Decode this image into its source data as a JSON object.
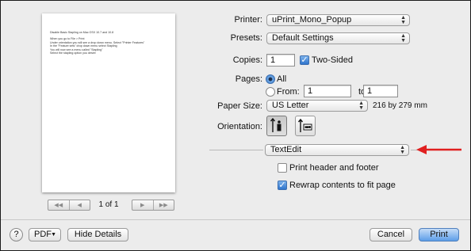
{
  "preview": {
    "lines": [
      "Disable Basic Stapling on Mac OSX 10.7 and 10.8",
      "When you go to File > Print",
      "Under orientation you will see a drop down menu. Select \"Printer Features\"",
      "In the \"Feature sets\" drop down menu select Stapling",
      "You will now see a menu called \"Stapling\"",
      "Select the stapling option you desire"
    ],
    "page_indicator": "1 of 1"
  },
  "printer": {
    "label": "Printer:",
    "value": "uPrint_Mono_Popup"
  },
  "presets": {
    "label": "Presets:",
    "value": "Default Settings"
  },
  "copies": {
    "label": "Copies:",
    "value": "1",
    "two_sided_label": "Two-Sided",
    "two_sided_checked": true
  },
  "pages": {
    "label": "Pages:",
    "all_label": "All",
    "from_label": "From:",
    "from_value": "1",
    "to_label": "to:",
    "to_value": "1"
  },
  "paper_size": {
    "label": "Paper Size:",
    "value": "US Letter",
    "dimensions": "216 by 279 mm"
  },
  "orientation": {
    "label": "Orientation:"
  },
  "section_popup": {
    "value": "TextEdit"
  },
  "options": {
    "print_header_footer": {
      "label": "Print header and footer",
      "checked": false
    },
    "rewrap_contents": {
      "label": "Rewrap contents to fit page",
      "checked": true
    }
  },
  "bottom": {
    "help": "?",
    "pdf": "PDF",
    "hide_details": "Hide Details",
    "cancel": "Cancel",
    "print": "Print"
  },
  "colors": {
    "annotation_arrow": "#e02020",
    "accent": "#3a7bd5"
  }
}
